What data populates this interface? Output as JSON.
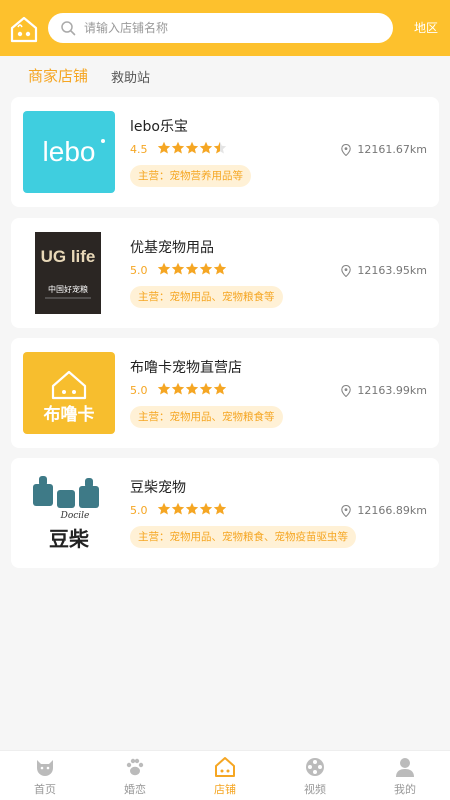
{
  "header": {
    "search_placeholder": "请输入店铺名称",
    "region_label": "地区"
  },
  "tabs": [
    {
      "label": "商家店铺",
      "active": true
    },
    {
      "label": "救助站",
      "active": false
    }
  ],
  "stores": [
    {
      "name": "lebo乐宝",
      "rating": "4.5",
      "rating_value": 4.5,
      "distance": "12161.67km",
      "tag": "主营：宠物营养用品等",
      "logo_text": "lebo"
    },
    {
      "name": "优基宠物用品",
      "rating": "5.0",
      "rating_value": 5.0,
      "distance": "12163.95km",
      "tag": "主营：宠物用品、宠物粮食等",
      "logo_text": "UG life",
      "logo_sub": "中国好宠粮"
    },
    {
      "name": "布噜卡宠物直营店",
      "rating": "5.0",
      "rating_value": 5.0,
      "distance": "12163.99km",
      "tag": "主营：宠物用品、宠物粮食等",
      "logo_text": "布噜卡"
    },
    {
      "name": "豆柴宠物",
      "rating": "5.0",
      "rating_value": 5.0,
      "distance": "12166.89km",
      "tag": "主营：宠物用品、宠物粮食、宠物疫苗驱虫等",
      "logo_text": "豆柴",
      "logo_sub": "Docile"
    }
  ],
  "nav": [
    {
      "label": "首页",
      "icon": "dog-head-icon",
      "active": false
    },
    {
      "label": "婚恋",
      "icon": "paw-icon",
      "active": false
    },
    {
      "label": "店铺",
      "icon": "store-house-icon",
      "active": true
    },
    {
      "label": "视频",
      "icon": "film-reel-icon",
      "active": false
    },
    {
      "label": "我的",
      "icon": "user-icon",
      "active": false
    }
  ],
  "colors": {
    "brand": "#FDC12D",
    "accent": "#F5A623",
    "tag_bg": "#FFF1D6"
  }
}
